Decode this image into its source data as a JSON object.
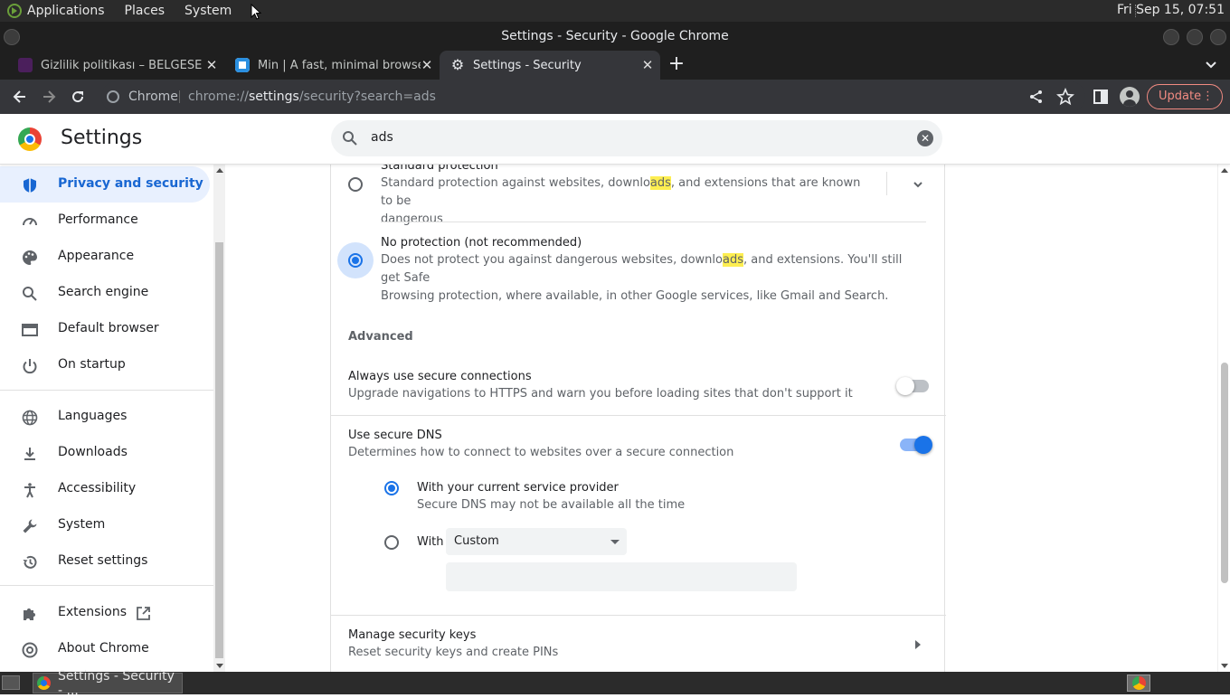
{
  "os_panel": {
    "menus": [
      "Applications",
      "Places",
      "System"
    ],
    "clock": "Fri Sep 15, 07:51"
  },
  "window": {
    "title": "Settings - Security - Google Chrome"
  },
  "tabs": [
    {
      "label": "Gizlilik politikası – BELGESELS",
      "favicon": "belgesel-icon",
      "active": false
    },
    {
      "label": "Min | A fast, minimal browser t",
      "favicon": "min-browser-icon",
      "active": false
    },
    {
      "label": "Settings - Security",
      "favicon": "gear-icon",
      "active": true
    }
  ],
  "toolbar": {
    "scheme_label": "Chrome",
    "url_prefix": "chrome://",
    "url_host": "settings",
    "url_path": "/security?search=ads",
    "update_label": "Update"
  },
  "settings_header": {
    "title": "Settings",
    "search_value": "ads"
  },
  "sidebar": {
    "items": [
      {
        "label": "Privacy and security",
        "icon": "shield-icon",
        "active": true
      },
      {
        "label": "Performance",
        "icon": "speedometer-icon"
      },
      {
        "label": "Appearance",
        "icon": "palette-icon"
      },
      {
        "label": "Search engine",
        "icon": "search-icon"
      },
      {
        "label": "Default browser",
        "icon": "browser-window-icon"
      },
      {
        "label": "On startup",
        "icon": "power-icon"
      },
      {
        "label": "Languages",
        "icon": "globe-icon"
      },
      {
        "label": "Downloads",
        "icon": "download-icon"
      },
      {
        "label": "Accessibility",
        "icon": "accessibility-icon"
      },
      {
        "label": "System",
        "icon": "wrench-icon"
      },
      {
        "label": "Reset settings",
        "icon": "history-icon"
      },
      {
        "label": "Extensions",
        "icon": "puzzle-icon"
      },
      {
        "label": "About Chrome",
        "icon": "chrome-icon"
      }
    ]
  },
  "main": {
    "standard_protection": {
      "title": "Standard protection",
      "desc_before": "Standard protection against websites, downlo",
      "desc_highlight": "ads",
      "desc_after": ", and extensions that are known to be",
      "desc_line2": "dangerous",
      "selected": false
    },
    "no_protection": {
      "title": "No protection (not recommended)",
      "desc_before": "Does not protect you against dangerous websites, downlo",
      "desc_highlight": "ads",
      "desc_after": ", and extensions. You'll still get Safe",
      "desc_line2": "Browsing protection, where available, in other Google services, like Gmail and Search.",
      "selected": true
    },
    "advanced_heading": "Advanced",
    "secure_connections": {
      "title": "Always use secure connections",
      "desc": "Upgrade navigations to HTTPS and warn you before loading sites that don't support it",
      "enabled": false
    },
    "secure_dns": {
      "title": "Use secure DNS",
      "desc": "Determines how to connect to websites over a secure connection",
      "enabled": true,
      "option_current_title": "With your current service provider",
      "option_current_desc": "Secure DNS may not be available all the time",
      "option_current_selected": true,
      "option_custom_label": "With",
      "option_custom_selected": false,
      "custom_select_value": "Custom",
      "custom_input_value": ""
    },
    "security_keys": {
      "title": "Manage security keys",
      "desc": "Reset security keys and create PINs"
    }
  },
  "taskbar": {
    "window_label": "Settings - Security - ..."
  },
  "colors": {
    "accent": "#1a73e8",
    "highlight": "#fdee51",
    "update_button": "#f28b82"
  }
}
